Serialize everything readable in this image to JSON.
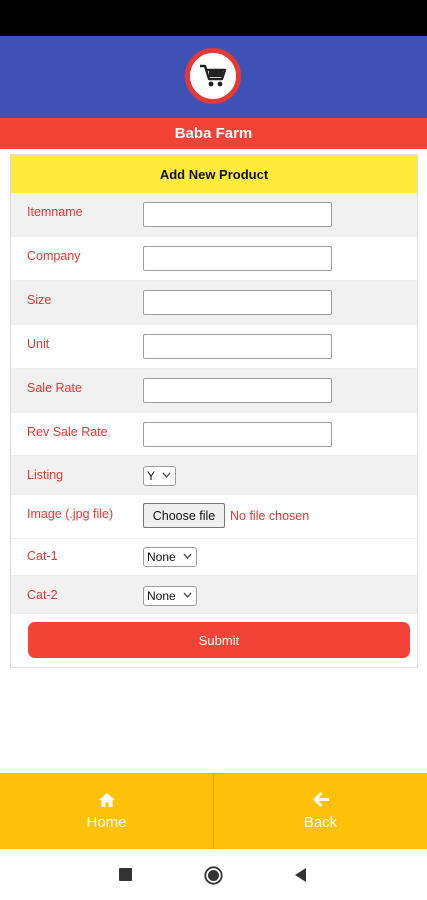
{
  "app": {
    "title": "Baba Farm",
    "logo_icon": "shopping-cart-icon",
    "colors": {
      "primary": "#3f51b5",
      "accent": "#f44336",
      "header": "#ffeb3b",
      "nav": "#ffc107"
    }
  },
  "form": {
    "heading": "Add New Product",
    "fields": [
      {
        "label": "Itemname",
        "value": ""
      },
      {
        "label": "Company",
        "value": ""
      },
      {
        "label": "Size",
        "value": ""
      },
      {
        "label": "Unit",
        "value": ""
      },
      {
        "label": "Sale Rate",
        "value": ""
      },
      {
        "label": "Rev Sale Rate",
        "value": ""
      }
    ],
    "listing": {
      "label": "Listing",
      "selected": "Y"
    },
    "image": {
      "label": "Image (.jpg file)",
      "button": "Choose file",
      "status": "No file chosen"
    },
    "cat1": {
      "label": "Cat-1",
      "selected": "None"
    },
    "cat2": {
      "label": "Cat-2",
      "selected": "None"
    },
    "submit_label": "Submit"
  },
  "bottom_nav": {
    "home": {
      "label": "Home",
      "icon": "home-icon"
    },
    "back": {
      "label": "Back",
      "icon": "arrow-left-icon"
    }
  },
  "system_nav": {
    "icons": [
      "recents-icon",
      "home-circle-icon",
      "back-triangle-icon"
    ]
  }
}
